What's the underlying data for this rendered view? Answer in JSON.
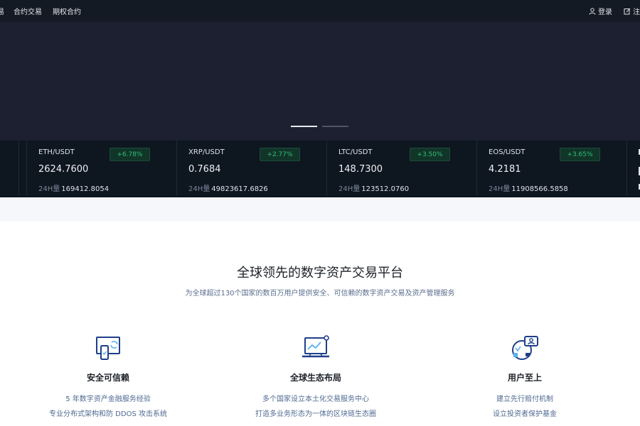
{
  "nav": {
    "left_items": [
      {
        "label": "易"
      },
      {
        "label": "合约交易"
      },
      {
        "label": "期权合约"
      }
    ],
    "right_items": [
      {
        "label": "登录",
        "icon": "user-icon"
      },
      {
        "label": "注册",
        "icon": "edit-icon"
      }
    ]
  },
  "banner": {
    "background": "#1c2030",
    "indicators": [
      {
        "active": true
      },
      {
        "active": false
      }
    ]
  },
  "tickers": [
    {
      "pair": "ETH/USDT",
      "price": "2624.7600",
      "change": "+6.78%",
      "volume_label": "24H量",
      "volume": "169412.8054"
    },
    {
      "pair": "XRP/USDT",
      "price": "0.7684",
      "change": "+2.77%",
      "volume_label": "24H量",
      "volume": "49823617.6826"
    },
    {
      "pair": "LTC/USDT",
      "price": "148.7300",
      "change": "+3.50%",
      "volume_label": "24H量",
      "volume": "123512.0760"
    },
    {
      "pair": "EOS/USDT",
      "price": "4.2181",
      "change": "+3.65%",
      "volume_label": "24H量",
      "volume": "11908566.5858"
    }
  ],
  "colors": {
    "up": "#2fbf7a",
    "up_bg": "#113528",
    "nav_bg": "#141a24",
    "ticker_bg": "#0e1620",
    "accent_blue": "#1f3f8a"
  },
  "features_section": {
    "title": "全球领先的数字资产交易平台",
    "subtitle": "为全球超过130个国家的数百万用户提供安全、可信赖的数字资产交易及资产管理服务",
    "features": [
      {
        "icon": "secure-device-icon",
        "title": "安全可信赖",
        "line1": "5 年数字资产金融服务经验",
        "line2": "专业分布式架构和防 DDOS 攻击系统"
      },
      {
        "icon": "global-chart-icon",
        "title": "全球生态布局",
        "line1": "多个国家设立本土化交易服务中心",
        "line2": "打造多业务形态为一体的区块链生态圈"
      },
      {
        "icon": "user-support-icon",
        "title": "用户至上",
        "line1": "建立先行赔付机制",
        "line2": "设立投资者保护基金"
      }
    ]
  }
}
